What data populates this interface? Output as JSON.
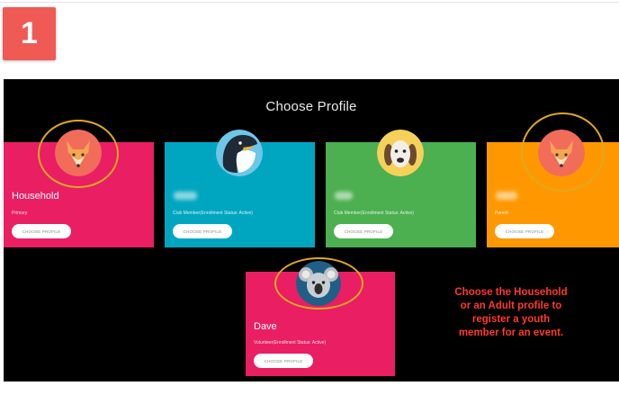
{
  "step": {
    "number": "1"
  },
  "screen": {
    "title": "Choose Profile"
  },
  "cards": [
    {
      "name": "Household",
      "role": "Primary",
      "button": "CHOOSE PROFILE",
      "avatar": "fox-icon",
      "color": "#e91e63"
    },
    {
      "name": "",
      "role": "Club Member(Enrollment Status: Active)",
      "button": "CHOOSE PROFILE",
      "avatar": "penguin-icon",
      "color": "#00a6c0"
    },
    {
      "name": "",
      "role": "Club Member(Enrollment Status: Active)",
      "button": "CHOOSE PROFILE",
      "avatar": "dog-icon",
      "color": "#4caf50"
    },
    {
      "name": "",
      "role": "Parent",
      "button": "CHOOSE PROFILE",
      "avatar": "fox-icon",
      "color": "#ff9800"
    },
    {
      "name": "Dave",
      "role": "Volunteer(Enrollment Status: Active)",
      "button": "CHOOSE PROFILE",
      "avatar": "koala-icon",
      "color": "#e91e63"
    }
  ],
  "callout": {
    "lines": [
      "Choose the Household",
      "or an Adult profile to",
      "register a youth",
      "member for an event."
    ],
    "color": "#ff3a2a"
  },
  "colors": {
    "highlight_ring": "#e0a81e",
    "badge": "#f05a55"
  }
}
